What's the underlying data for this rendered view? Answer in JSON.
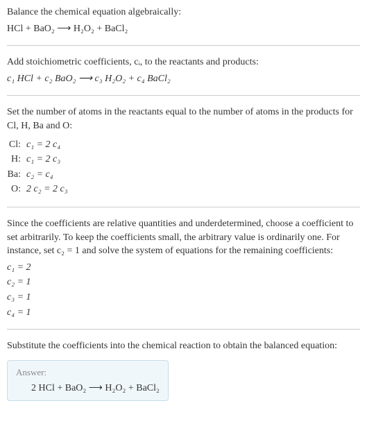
{
  "section1": {
    "heading": "Balance the chemical equation algebraically:",
    "equation": "HCl + BaO₂  ⟶  H₂O₂ + BaCl₂"
  },
  "section2": {
    "heading": "Add stoichiometric coefficients, cᵢ, to the reactants and products:",
    "equation": "c₁ HCl + c₂ BaO₂  ⟶  c₃ H₂O₂ + c₄ BaCl₂"
  },
  "section3": {
    "heading": "Set the number of atoms in the reactants equal to the number of atoms in the products for Cl, H, Ba and O:",
    "rows": [
      {
        "label": "Cl:",
        "eq": "c₁ = 2 c₄"
      },
      {
        "label": "H:",
        "eq": "c₁ = 2 c₃"
      },
      {
        "label": "Ba:",
        "eq": "c₂ = c₄"
      },
      {
        "label": "O:",
        "eq": "2 c₂ = 2 c₃"
      }
    ]
  },
  "section4": {
    "heading": "Since the coefficients are relative quantities and underdetermined, choose a coefficient to set arbitrarily. To keep the coefficients small, the arbitrary value is ordinarily one. For instance, set c₂ = 1 and solve the system of equations for the remaining coefficients:",
    "coefs": [
      "c₁ = 2",
      "c₂ = 1",
      "c₃ = 1",
      "c₄ = 1"
    ]
  },
  "section5": {
    "heading": "Substitute the coefficients into the chemical reaction to obtain the balanced equation:",
    "answer_label": "Answer:",
    "answer_equation": "2 HCl + BaO₂  ⟶  H₂O₂ + BaCl₂"
  }
}
